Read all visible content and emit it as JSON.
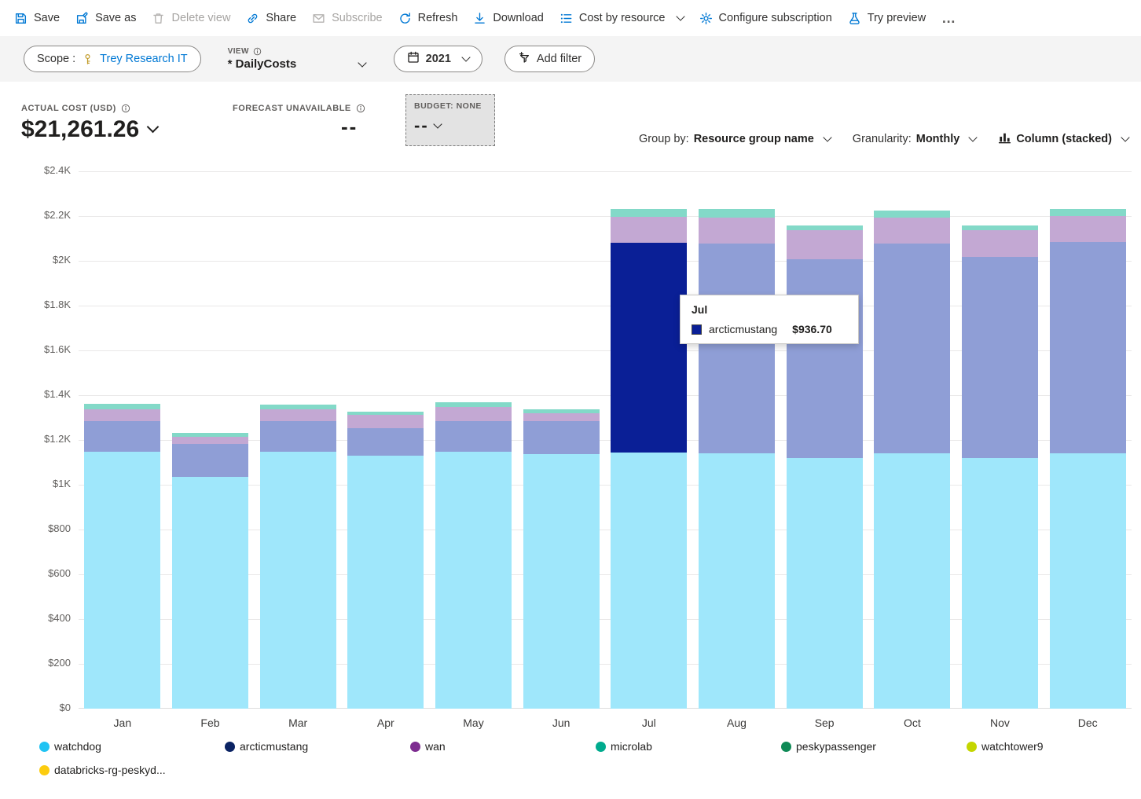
{
  "toolbar": {
    "items": [
      {
        "id": "save",
        "label": "Save",
        "icon": "save",
        "disabled": false
      },
      {
        "id": "save-as",
        "label": "Save as",
        "icon": "save-as",
        "disabled": false
      },
      {
        "id": "delete-view",
        "label": "Delete view",
        "icon": "trash",
        "disabled": true
      },
      {
        "id": "share",
        "label": "Share",
        "icon": "share",
        "disabled": false
      },
      {
        "id": "subscribe",
        "label": "Subscribe",
        "icon": "mail",
        "disabled": true
      },
      {
        "id": "refresh",
        "label": "Refresh",
        "icon": "refresh",
        "disabled": false
      },
      {
        "id": "download",
        "label": "Download",
        "icon": "download",
        "disabled": false
      },
      {
        "id": "cost-by-resource",
        "label": "Cost by resource",
        "icon": "list",
        "chevron": true,
        "disabled": false
      },
      {
        "id": "configure-subscription",
        "label": "Configure subscription",
        "icon": "gear",
        "disabled": false
      },
      {
        "id": "try-preview",
        "label": "Try preview",
        "icon": "beaker",
        "disabled": false
      },
      {
        "id": "more",
        "label": "…",
        "icon": "",
        "disabled": false
      }
    ]
  },
  "filter_bar": {
    "scope_label": "Scope :",
    "scope_value": "Trey Research IT",
    "view_label": "VIEW",
    "view_value": "* DailyCosts",
    "date_value": "2021",
    "add_filter_label": "Add filter"
  },
  "kpi": {
    "actual_cost_label": "ACTUAL COST (USD)",
    "actual_cost_value": "$21,261.26",
    "forecast_label": "FORECAST UNAVAILABLE",
    "forecast_value": "--",
    "budget_label": "BUDGET: NONE",
    "budget_value": "--"
  },
  "controls": {
    "group_by_label": "Group by:",
    "group_by_value": "Resource group name",
    "granularity_label": "Granularity:",
    "granularity_value": "Monthly",
    "chart_type_label": "Column (stacked)"
  },
  "chart_data": {
    "type": "bar",
    "stacked": true,
    "title": "",
    "xlabel": "",
    "ylabel": "",
    "ylim": [
      0,
      2400
    ],
    "grid": true,
    "legend_position": "bottom",
    "categories": [
      "Jan",
      "Feb",
      "Mar",
      "Apr",
      "May",
      "Jun",
      "Jul",
      "Aug",
      "Sep",
      "Oct",
      "Nov",
      "Dec"
    ],
    "yticks": [
      "$0",
      "$200",
      "$400",
      "$600",
      "$800",
      "$1K",
      "$1.2K",
      "$1.4K",
      "$1.6K",
      "$1.8K",
      "$2K",
      "$2.2K",
      "$2.4K"
    ],
    "series": [
      {
        "name": "watchdog",
        "color": "#9fe7fb",
        "values": [
          1147,
          1035,
          1147,
          1130,
          1147,
          1137,
          1144,
          1140,
          1119,
          1140,
          1119,
          1140
        ]
      },
      {
        "name": "arcticmustang",
        "color": "#8f9ed6",
        "highlight_color": "#0a1f96",
        "values": [
          137,
          148,
          137,
          123,
          137,
          147,
          936.7,
          937,
          888,
          937,
          899,
          944
        ]
      },
      {
        "name": "wan",
        "color": "#c3a8d3",
        "values": [
          53,
          31,
          53,
          59,
          63,
          35,
          116,
          116,
          130,
          116,
          119,
          116
        ]
      },
      {
        "name": "microlab",
        "color": "#83d9c8",
        "values": [
          24,
          18,
          21,
          14,
          21,
          18,
          35,
          39,
          21,
          32,
          21,
          32
        ]
      }
    ],
    "highlight": {
      "series": "arcticmustang",
      "category": "Jul"
    }
  },
  "tooltip": {
    "title": "Jul",
    "series": "arcticmustang",
    "value": "$936.70",
    "swatch_color": "#0a1f96"
  },
  "legend": {
    "items": [
      {
        "label": "watchdog",
        "color": "#20c3f3"
      },
      {
        "label": "arcticmustang",
        "color": "#0b2363"
      },
      {
        "label": "wan",
        "color": "#7d2c90"
      },
      {
        "label": "microlab",
        "color": "#00ab8e"
      },
      {
        "label": "peskypassenger",
        "color": "#0f8a56"
      },
      {
        "label": "watchtower9",
        "color": "#c4d600"
      },
      {
        "label": "databricks-rg-peskyd...",
        "color": "#fccc0f"
      }
    ]
  }
}
